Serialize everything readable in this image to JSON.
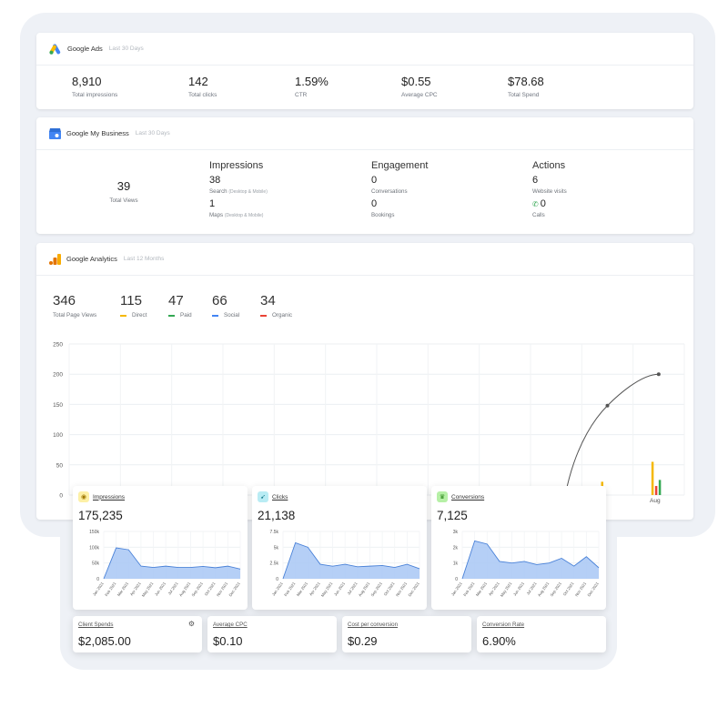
{
  "ads": {
    "title": "Google Ads",
    "range": "Last 30 Days",
    "stats": [
      {
        "value": "8,910",
        "label": "Total impressions"
      },
      {
        "value": "142",
        "label": "Total clicks"
      },
      {
        "value": "1.59%",
        "label": "CTR"
      },
      {
        "value": "$0.55",
        "label": "Average CPC"
      },
      {
        "value": "$78.68",
        "label": "Total Spend"
      }
    ]
  },
  "gmb": {
    "title": "Google My Business",
    "range": "Last 30 Days",
    "total": {
      "value": "39",
      "label": "Total Views"
    },
    "impressions": {
      "heading": "Impressions",
      "search_value": "38",
      "search_label": "Search",
      "search_note": "(Desktop & Mobile)",
      "maps_value": "1",
      "maps_label": "Maps",
      "maps_note": "(Desktop & Mobile)"
    },
    "engagement": {
      "heading": "Engagement",
      "conversations_value": "0",
      "conversations_label": "Conversations",
      "bookings_value": "0",
      "bookings_label": "Bookings"
    },
    "actions": {
      "heading": "Actions",
      "website_value": "6",
      "website_label": "Website visits",
      "calls_value": "0",
      "calls_label": "Calls"
    }
  },
  "analytics": {
    "title": "Google Analytics",
    "range": "Last 12 Months",
    "total": {
      "value": "346",
      "label": "Total Page Views"
    },
    "channels": [
      {
        "value": "115",
        "label": "Direct",
        "color": "#f5b800"
      },
      {
        "value": "47",
        "label": "Paid",
        "color": "#34a853"
      },
      {
        "value": "66",
        "label": "Social",
        "color": "#4285f4"
      },
      {
        "value": "34",
        "label": "Organic",
        "color": "#ea4335"
      }
    ]
  },
  "chart_data": [
    {
      "type": "line",
      "title": "",
      "y_ticks": [
        "0",
        "50",
        "100",
        "150",
        "200",
        "250"
      ],
      "ylim": [
        0,
        250
      ],
      "x_tick_visible": "Aug",
      "series": [
        {
          "values": [
            0,
            0,
            0,
            0,
            0,
            0,
            0,
            0,
            0,
            0,
            148,
            200
          ]
        }
      ],
      "bars_aug": [
        {
          "name": "Direct",
          "value": 55,
          "color": "#f5b800"
        },
        {
          "name": "Organic",
          "value": 15,
          "color": "#ea4335"
        },
        {
          "name": "Paid",
          "value": 25,
          "color": "#34a853"
        }
      ]
    },
    {
      "type": "area",
      "title": "Impressions",
      "categories": [
        "Jan 2021",
        "Feb 2021",
        "Mar 2021",
        "Apr 2021",
        "May 2021",
        "Jun 2021",
        "Jul 2021",
        "Aug 2021",
        "Sep 2021",
        "Oct 2021",
        "Nov 2021",
        "Dec 2021"
      ],
      "y_ticks": [
        "0",
        "50k",
        "100k",
        "150k"
      ],
      "ylim": [
        0,
        150000
      ],
      "values": [
        0,
        98000,
        92000,
        40000,
        36000,
        40000,
        36000,
        36000,
        39000,
        35000,
        40000,
        31000
      ]
    },
    {
      "type": "area",
      "title": "Clicks",
      "categories": [
        "Jan 2021",
        "Feb 2021",
        "Mar 2021",
        "Apr 2021",
        "May 2021",
        "Jun 2021",
        "Jul 2021",
        "Aug 2021",
        "Sep 2021",
        "Oct 2021",
        "Nov 2021",
        "Dec 2021"
      ],
      "y_ticks": [
        "0",
        "2.5k",
        "5k",
        "7.5k"
      ],
      "ylim": [
        0,
        7500
      ],
      "values": [
        0,
        5700,
        5000,
        2300,
        2000,
        2300,
        1900,
        2000,
        2100,
        1800,
        2300,
        1600
      ]
    },
    {
      "type": "area",
      "title": "Conversions",
      "categories": [
        "Jan 2021",
        "Feb 2021",
        "Mar 2021",
        "Apr 2021",
        "May 2021",
        "Jun 2021",
        "Jul 2021",
        "Aug 2021",
        "Sep 2021",
        "Oct 2021",
        "Nov 2021",
        "Dec 2021"
      ],
      "y_ticks": [
        "0",
        "1k",
        "2k",
        "3k"
      ],
      "ylim": [
        0,
        3000
      ],
      "values": [
        0,
        2400,
        2200,
        1100,
        1000,
        1100,
        900,
        1000,
        1300,
        800,
        1400,
        700
      ]
    }
  ],
  "panels": {
    "impressions": {
      "title": "Impressions",
      "value": "175,235"
    },
    "clicks": {
      "title": "Clicks",
      "value": "21,138"
    },
    "conversions": {
      "title": "Conversions",
      "value": "7,125"
    }
  },
  "kpis": [
    {
      "label": "Client Spends",
      "value": "$2,085.00"
    },
    {
      "label": "Average CPC",
      "value": "$0.10"
    },
    {
      "label": "Cost per conversion",
      "value": "$0.29"
    },
    {
      "label": "Conversion Rate",
      "value": "6.90%"
    }
  ],
  "colors": {
    "ads_blue": "#4285f4",
    "ads_yellow": "#fbbc04",
    "ads_green": "#34a853",
    "area_fill": "#a8c7f5",
    "area_line": "#4a82d8"
  }
}
